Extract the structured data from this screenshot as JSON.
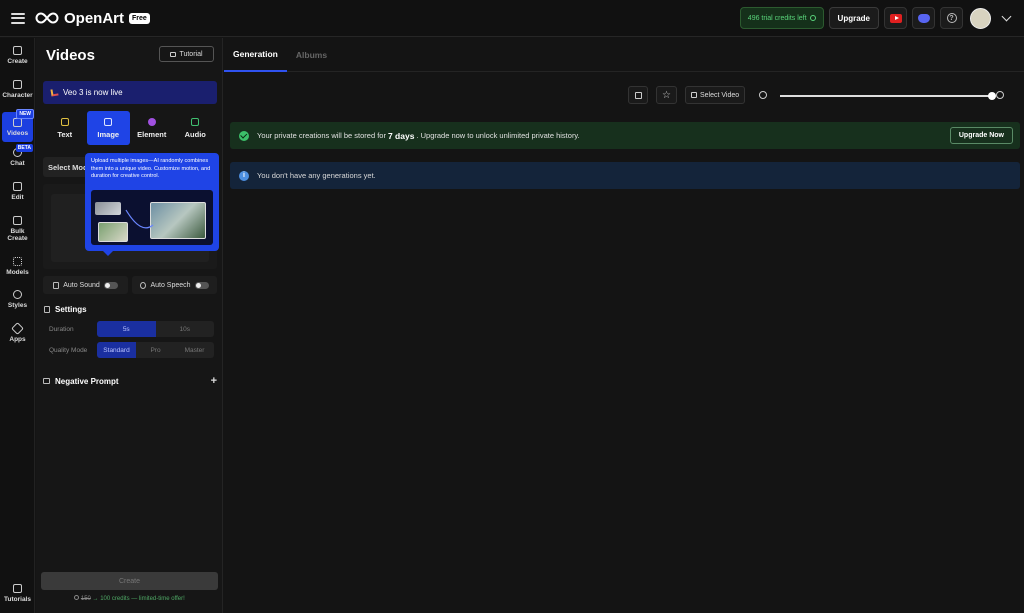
{
  "header": {
    "brand": "OpenArt",
    "plan_badge": "Free",
    "credits_text": "496 trial credits left",
    "upgrade_label": "Upgrade",
    "help_glyph": "?"
  },
  "rail": {
    "items": [
      {
        "label": "Create",
        "icon": "create-icon"
      },
      {
        "label": "Character",
        "icon": "character-icon"
      },
      {
        "label": "Videos",
        "icon": "video-icon",
        "tag": "NEW"
      },
      {
        "label": "Chat",
        "icon": "chat-icon",
        "tag": "BETA"
      },
      {
        "label": "Edit",
        "icon": "edit-icon"
      },
      {
        "label": "Bulk Create",
        "icon": "bulk-create-icon"
      },
      {
        "label": "Models",
        "icon": "models-icon"
      },
      {
        "label": "Styles",
        "icon": "styles-icon"
      },
      {
        "label": "Apps",
        "icon": "apps-icon"
      }
    ],
    "tutorials_label": "Tutorials"
  },
  "panel": {
    "title": "Videos",
    "tutorial_label": "Tutorial",
    "banner": "Veo 3 is now live",
    "mode_tabs": [
      {
        "label": "Text",
        "color": "#e0c040"
      },
      {
        "label": "Image",
        "color": "#9fb4ff"
      },
      {
        "label": "Element",
        "color": "#a050e0"
      },
      {
        "label": "Audio",
        "color": "#40c070"
      }
    ],
    "select_model_label": "Select Mod",
    "auto_sound_label": "Auto Sound",
    "auto_speech_label": "Auto Speech",
    "settings_label": "Settings",
    "duration_label": "Duration",
    "duration_options": [
      "5s",
      "10s"
    ],
    "quality_label": "Quality Mode",
    "quality_options": [
      "Standard",
      "Pro",
      "Master"
    ],
    "negative_prompt_label": "Negative Prompt",
    "create_label": "Create",
    "credit_cost": "150",
    "credit_offer": "100 credits — limited-time offer!"
  },
  "tooltip": {
    "text": "Upload multiple images—AI randomly combines them into a unique video. Customize motion, and duration for creative control."
  },
  "main": {
    "tabs": [
      "Generation",
      "Albums"
    ],
    "select_video_label": "Select Video",
    "zoom_level": 1.0,
    "notice_storage_pre": "Your private creations will be stored for",
    "notice_storage_bold": "7 days",
    "notice_storage_post": ". Upgrade now to unlock unlimited private history.",
    "upgrade_now_label": "Upgrade Now",
    "notice_empty": "You don't have any generations yet.",
    "info_glyph": "i"
  }
}
